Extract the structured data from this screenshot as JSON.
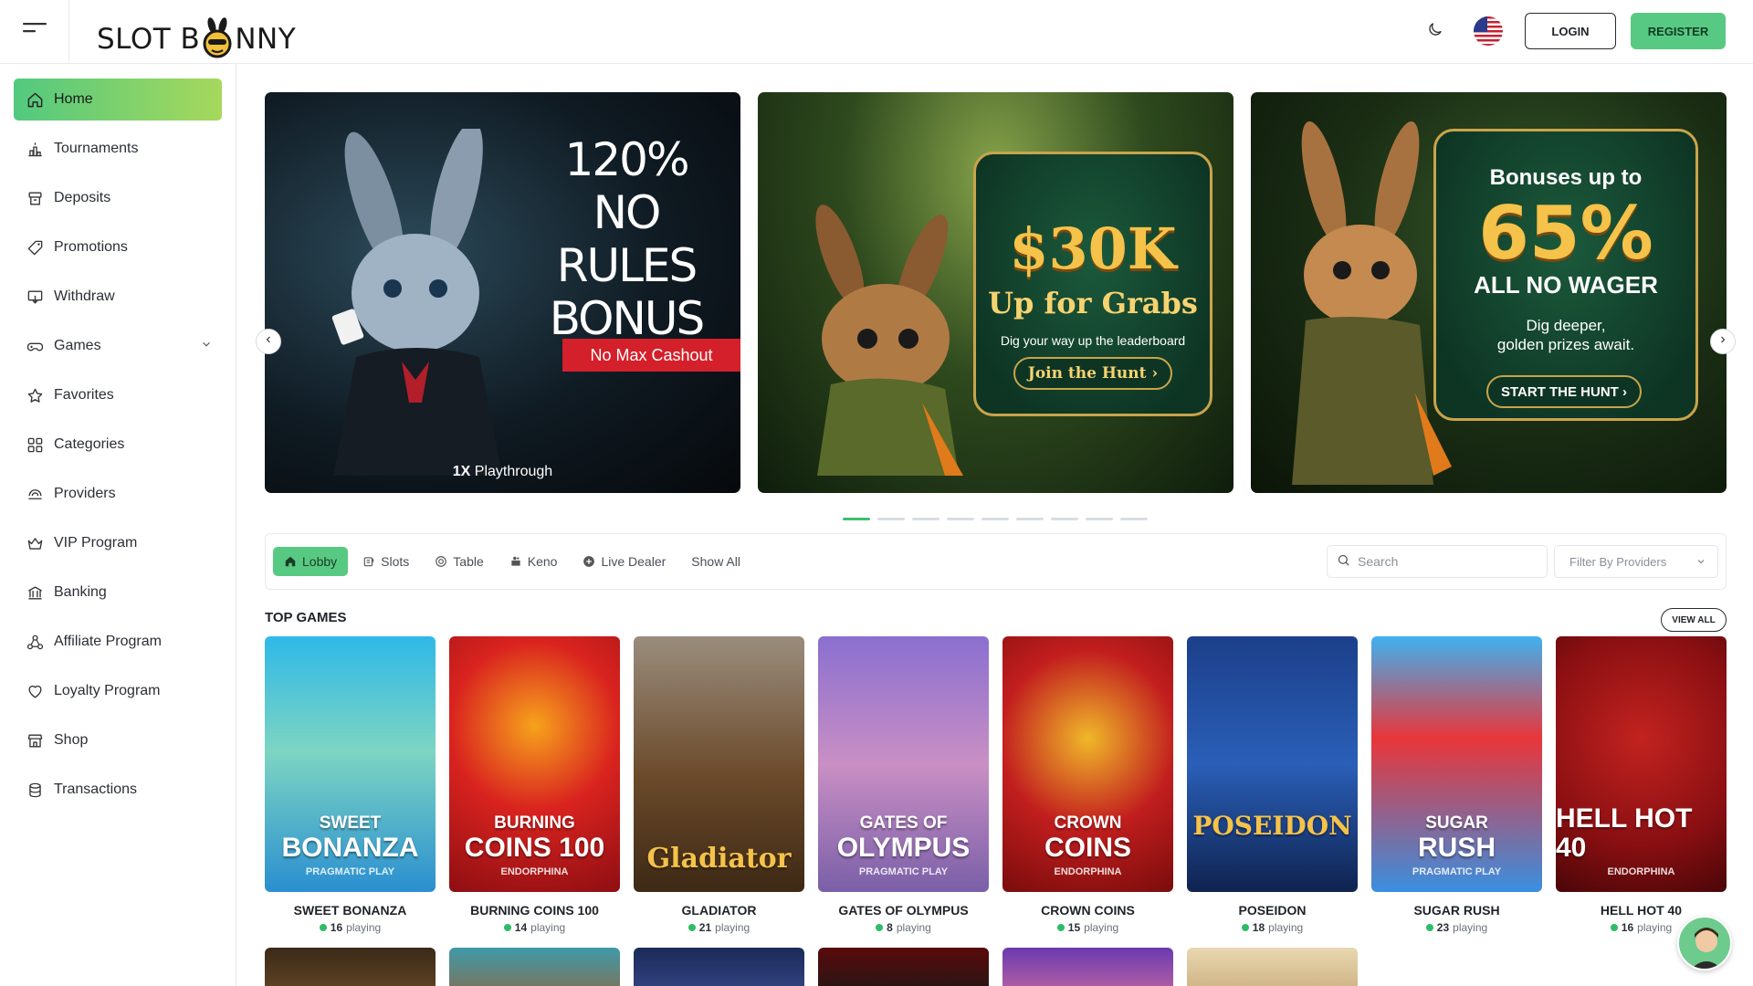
{
  "header": {
    "logo_text_left": "SLOT B",
    "logo_text_right": "NNY",
    "login_label": "LOGIN",
    "register_label": "REGISTER"
  },
  "sidebar": {
    "items": [
      {
        "label": "Home",
        "icon": "home-icon"
      },
      {
        "label": "Tournaments",
        "icon": "podium-icon"
      },
      {
        "label": "Deposits",
        "icon": "deposit-icon"
      },
      {
        "label": "Promotions",
        "icon": "tag-icon"
      },
      {
        "label": "Withdraw",
        "icon": "withdraw-icon"
      },
      {
        "label": "Games",
        "icon": "gamepad-icon"
      },
      {
        "label": "Favorites",
        "icon": "star-icon"
      },
      {
        "label": "Categories",
        "icon": "grid-icon"
      },
      {
        "label": "Providers",
        "icon": "providers-icon"
      },
      {
        "label": "VIP Program",
        "icon": "crown-icon"
      },
      {
        "label": "Banking",
        "icon": "bank-icon"
      },
      {
        "label": "Affiliate Program",
        "icon": "affiliate-icon"
      },
      {
        "label": "Loyalty Program",
        "icon": "heart-icon"
      },
      {
        "label": "Shop",
        "icon": "shop-icon"
      },
      {
        "label": "Transactions",
        "icon": "transactions-icon"
      }
    ]
  },
  "banners": {
    "b1": {
      "title_l1": "120%",
      "title_l2": "NO",
      "title_l3": "RULES",
      "title_l4": "BONUS",
      "tag": "No Max Cashout",
      "play_bold": "1X",
      "play_rest": " Playthrough"
    },
    "b2": {
      "big": "$30K",
      "sub": "Up for Grabs",
      "small": "Dig your way up the leaderboard",
      "cta": "Join the Hunt ›"
    },
    "b3": {
      "top": "Bonuses up to",
      "big": "65%",
      "mid": "ALL NO WAGER",
      "small_l1": "Dig deeper,",
      "small_l2": "golden prizes await.",
      "cta": "START THE HUNT ›"
    }
  },
  "filters": {
    "tabs": [
      {
        "label": "Lobby",
        "icon": "home-icon"
      },
      {
        "label": "Slots",
        "icon": "slots-icon"
      },
      {
        "label": "Table",
        "icon": "chip-icon"
      },
      {
        "label": "Keno",
        "icon": "keno-icon"
      },
      {
        "label": "Live Dealer",
        "icon": "plus-circle-icon"
      },
      {
        "label": "Show All",
        "icon": ""
      }
    ],
    "search_placeholder": "Search",
    "provider_placeholder": "Filter By Providers"
  },
  "top_games": {
    "title": "TOP GAMES",
    "view_all": "VIEW ALL",
    "items": [
      {
        "name": "SWEET BONANZA",
        "t1": "SWEET",
        "t2": "BONANZA",
        "provider": "PRAGMATIC PLAY",
        "playing": "16",
        "playing_word": "playing",
        "bg": "linear-gradient(180deg,#2fb8e8 0%,#7dd5c2 45%,#2a8fd0 100%)"
      },
      {
        "name": "BURNING COINS 100",
        "t1": "BURNING",
        "t2": "COINS 100",
        "provider": "ENDORPHINA",
        "playing": "14",
        "playing_word": "playing",
        "bg": "radial-gradient(circle at 50% 35%,#f7a31c 0%,#d9231f 45%,#8e0e12 100%)"
      },
      {
        "name": "GLADIATOR",
        "t1": "",
        "t2": "Gladiator",
        "provider": "",
        "playing": "21",
        "playing_word": "playing",
        "bg": "linear-gradient(180deg,#9a8d7d 0%,#6b4a2a 55%,#3d2915 100%)"
      },
      {
        "name": "GATES OF OLYMPUS",
        "t1": "GATES OF",
        "t2": "OLYMPUS",
        "provider": "PRAGMATIC PLAY",
        "playing": "8",
        "playing_word": "playing",
        "bg": "linear-gradient(180deg,#8a6fd0 0%,#c98fc4 50%,#7a5fa8 100%)"
      },
      {
        "name": "CROWN COINS",
        "t1": "CROWN",
        "t2": "COINS",
        "provider": "ENDORPHINA",
        "playing": "15",
        "playing_word": "playing",
        "bg": "radial-gradient(circle at 50% 40%,#f0b82a 0%,#c21e1e 50%,#7a0c0c 100%)"
      },
      {
        "name": "POSEIDON",
        "t1": "",
        "t2": "POSEIDON",
        "provider": "",
        "playing": "18",
        "playing_word": "playing",
        "bg": "linear-gradient(180deg,#1c3f8a 0%,#2a5fb8 50%,#0f2350 100%)"
      },
      {
        "name": "SUGAR RUSH",
        "t1": "SUGAR",
        "t2": "RUSH",
        "provider": "PRAGMATIC PLAY",
        "playing": "23",
        "playing_word": "playing",
        "bg": "linear-gradient(180deg,#3fb1f0 0%,#e8363a 40%,#3a8fe0 100%)"
      },
      {
        "name": "HELL HOT 40",
        "t1": "",
        "t2": "HELL HOT 40",
        "provider": "ENDORPHINA",
        "playing": "16",
        "playing_word": "playing",
        "bg": "radial-gradient(circle at 50% 40%,#c2231f 0%,#8a0f12 60%,#4a0608 100%)"
      }
    ]
  },
  "colors": {
    "accent_green": "#58c982",
    "active_gradient_end": "#a6d85c"
  }
}
